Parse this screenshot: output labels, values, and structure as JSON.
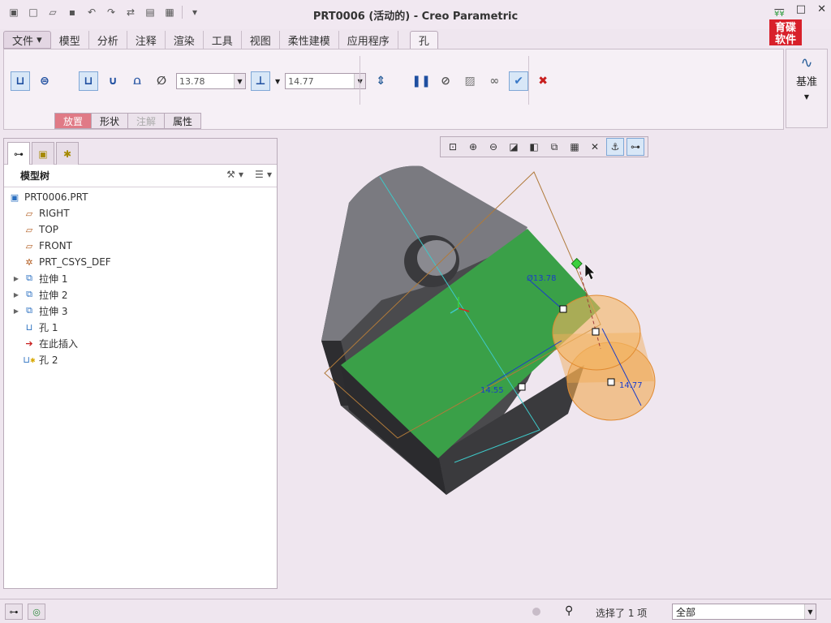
{
  "window": {
    "title": "PRT0006 (活动的) - Creo Parametric"
  },
  "ribbon": {
    "tabs": [
      {
        "label": "文件"
      },
      {
        "label": "模型"
      },
      {
        "label": "分析"
      },
      {
        "label": "注释"
      },
      {
        "label": "渲染"
      },
      {
        "label": "工具"
      },
      {
        "label": "视图"
      },
      {
        "label": "柔性建模"
      },
      {
        "label": "应用程序"
      },
      {
        "label": "孔"
      }
    ],
    "diameter_value": "13.78",
    "depth_value": "14.77",
    "subtabs": [
      {
        "label": "放置"
      },
      {
        "label": "形状"
      },
      {
        "label": "注解"
      },
      {
        "label": "属性"
      }
    ],
    "datum_label": "基准"
  },
  "logo": {
    "line1": "育碟",
    "line2": "软件"
  },
  "model_tree": {
    "header": "模型树",
    "nodes": [
      {
        "label": "PRT0006.PRT"
      },
      {
        "label": "RIGHT"
      },
      {
        "label": "TOP"
      },
      {
        "label": "FRONT"
      },
      {
        "label": "PRT_CSYS_DEF"
      },
      {
        "label": "拉伸 1"
      },
      {
        "label": "拉伸 2"
      },
      {
        "label": "拉伸 3"
      },
      {
        "label": "孔 1"
      },
      {
        "label": "在此插入"
      },
      {
        "label": "孔 2"
      }
    ]
  },
  "viewport": {
    "dim_diameter": "Ø13.78",
    "dim_depth": "14.77",
    "dim_offset": "14.55"
  },
  "status": {
    "message": "选择了 1 项",
    "filter": "全部"
  },
  "colors": {
    "accent_tab": "#e07a86",
    "face_green": "#3aa048",
    "hole_orange": "#f0a850",
    "body_grey": "#3c3c3e"
  }
}
